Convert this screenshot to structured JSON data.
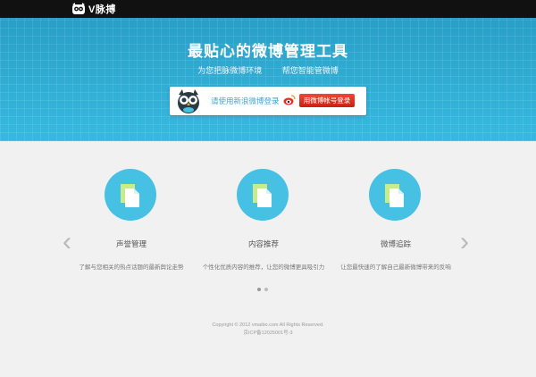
{
  "topbar": {
    "brand_name": "V脉搏"
  },
  "hero": {
    "title": "最贴心的微博管理工具",
    "subtitle_left": "为您把脉微博环境",
    "subtitle_right": "帮您智能管微博",
    "login_prompt": "请使用新浪微博登录",
    "login_button": "用微博帐号登录"
  },
  "features": [
    {
      "title": "声誉管理",
      "description": "了解与您相关的热点话题的最新舆论走势"
    },
    {
      "title": "内容推荐",
      "description": "个性化优质内容的推荐，让您的微博更具吸引力"
    },
    {
      "title": "微博追踪",
      "description": "让您最快速的了解自己最新微博带来的反响"
    }
  ],
  "carousel": {
    "prev": "‹",
    "next": "›"
  },
  "footer": {
    "copyright": "Copyright © 2012 vmaibo.com All Rights Reserved.",
    "icp": "京ICP备12025001号-3"
  },
  "colors": {
    "hero_bg": "#2fb2d9",
    "accent_circle": "#46c0e3",
    "login_red": "#e2321f",
    "topbar": "#111111"
  },
  "icons": {
    "brand": "owl-logo-icon",
    "feature": "document-icon",
    "weibo": "weibo-logo-icon"
  }
}
